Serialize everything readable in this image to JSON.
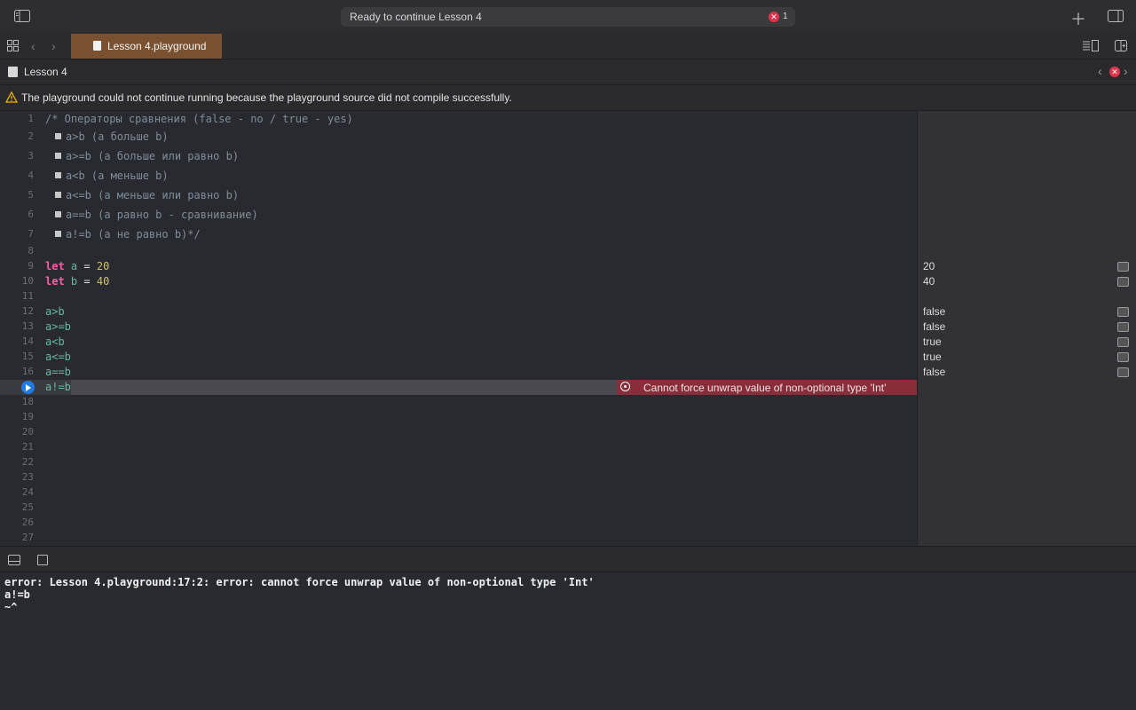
{
  "toolbar": {
    "status_text": "Ready to continue Lesson 4",
    "error_count": "1",
    "icons": [
      "sidebar-toggle-icon",
      "plus-icon",
      "inspector-toggle-icon"
    ]
  },
  "tabbar": {
    "tab_label": "Lesson 4.playground"
  },
  "jumpbar": {
    "file": "Lesson 4"
  },
  "warning": {
    "text": "The playground could not continue running because the playground source did not compile successfully."
  },
  "editor": {
    "lines": [
      {
        "n": "1",
        "text": "/* Операторы сравнения (false - no / true - yes)"
      },
      {
        "n": "2",
        "text": "a>b (a больше b)"
      },
      {
        "n": "3",
        "text": "a>=b (a больше или равно b)"
      },
      {
        "n": "4",
        "text": "a<b (a меньше b)"
      },
      {
        "n": "5",
        "text": "a<=b (a меньше или равно b)"
      },
      {
        "n": "6",
        "text": "a==b (a равно b - сравнивание)"
      },
      {
        "n": "7",
        "text": "a!=b (a не равно b)*/"
      },
      {
        "n": "8",
        "text": ""
      },
      {
        "n": "9",
        "kw": "let",
        "id": "a",
        "op": " = ",
        "num": "20"
      },
      {
        "n": "10",
        "kw": "let",
        "id": "b",
        "op": " = ",
        "num": "40"
      },
      {
        "n": "11",
        "text": ""
      },
      {
        "n": "12",
        "text": "a>b"
      },
      {
        "n": "13",
        "text": "a>=b"
      },
      {
        "n": "14",
        "text": "a<b"
      },
      {
        "n": "15",
        "text": "a<=b"
      },
      {
        "n": "16",
        "text": "a==b"
      },
      {
        "n": "17",
        "text": "a!=b"
      },
      {
        "n": "18"
      },
      {
        "n": "19"
      },
      {
        "n": "20"
      },
      {
        "n": "21"
      },
      {
        "n": "22"
      },
      {
        "n": "23"
      },
      {
        "n": "24"
      },
      {
        "n": "25"
      },
      {
        "n": "26"
      },
      {
        "n": "27"
      }
    ],
    "error_message": "Cannot force unwrap value of non-optional type 'Int'"
  },
  "results": [
    {
      "line": "9",
      "value": "20"
    },
    {
      "line": "10",
      "value": "40"
    },
    {
      "line": "12",
      "value": "false"
    },
    {
      "line": "13",
      "value": "false"
    },
    {
      "line": "14",
      "value": "true"
    },
    {
      "line": "15",
      "value": "true"
    },
    {
      "line": "16",
      "value": "false"
    }
  ],
  "console": {
    "lines": [
      "error: Lesson 4.playground:17:2: error: cannot force unwrap value of non-optional type 'Int'",
      "a!=b",
      "~^"
    ]
  },
  "colors": {
    "accent": "#1f7ae6",
    "error": "#e0314b",
    "tab": "#7a5232",
    "keyword": "#fc5fa3",
    "number": "#d0bf69"
  }
}
